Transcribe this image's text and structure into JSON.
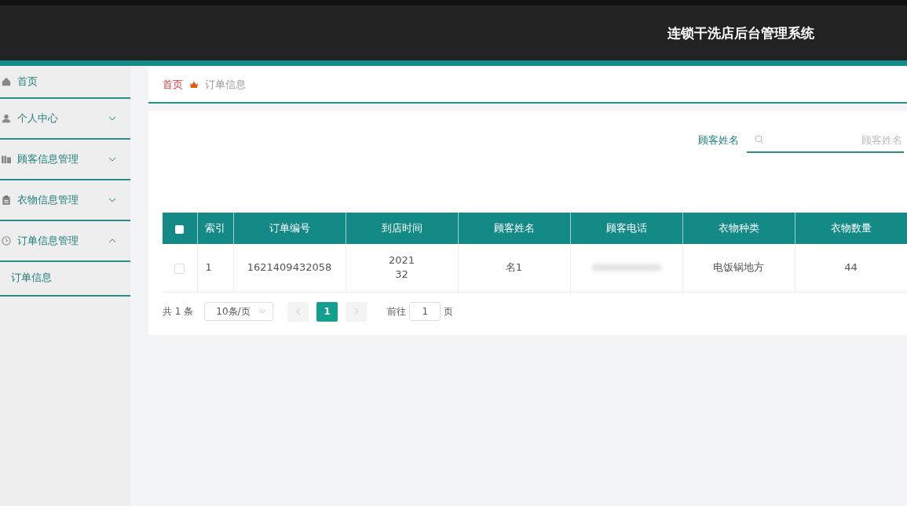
{
  "header": {
    "title": "连锁干洗店后台管理系统"
  },
  "sidebar": {
    "items": [
      {
        "label": "首页"
      },
      {
        "label": "个人中心",
        "expanded": false
      },
      {
        "label": "顾客信息管理",
        "expanded": false
      },
      {
        "label": "衣物信息管理",
        "expanded": false
      },
      {
        "label": "订单信息管理",
        "expanded": true,
        "children": [
          {
            "label": "订单信息",
            "selected": true
          }
        ]
      }
    ]
  },
  "breadcrumb": [
    {
      "label": "首页",
      "current": false
    },
    {
      "label": "订单信息",
      "current": true
    }
  ],
  "search": {
    "label": "顾客姓名",
    "placeholder": "顾客姓名"
  },
  "table": {
    "select_all_checked": false,
    "columns": [
      "索引",
      "订单编号",
      "到店时间",
      "顾客姓名",
      "顾客电话",
      "衣物种类",
      "衣物数量"
    ],
    "rows": [
      {
        "checked": false,
        "cells": [
          {
            "lines": [
              "1"
            ]
          },
          {
            "lines": [
              "1621409432058"
            ]
          },
          {
            "lines": [
              "2021",
              "32"
            ]
          },
          {
            "lines": [
              "名1"
            ]
          },
          {
            "kind": "redacted"
          },
          {
            "lines": [
              "电饭锅地方"
            ]
          },
          {
            "lines": [
              "44"
            ]
          }
        ]
      }
    ]
  },
  "pagination": {
    "total": "共 1 条",
    "page_size": "10条/页",
    "pages": [
      {
        "label": "1",
        "selected": true
      }
    ],
    "goto_label": "前往",
    "goto_value": "1",
    "goto_suffix": "页"
  }
}
